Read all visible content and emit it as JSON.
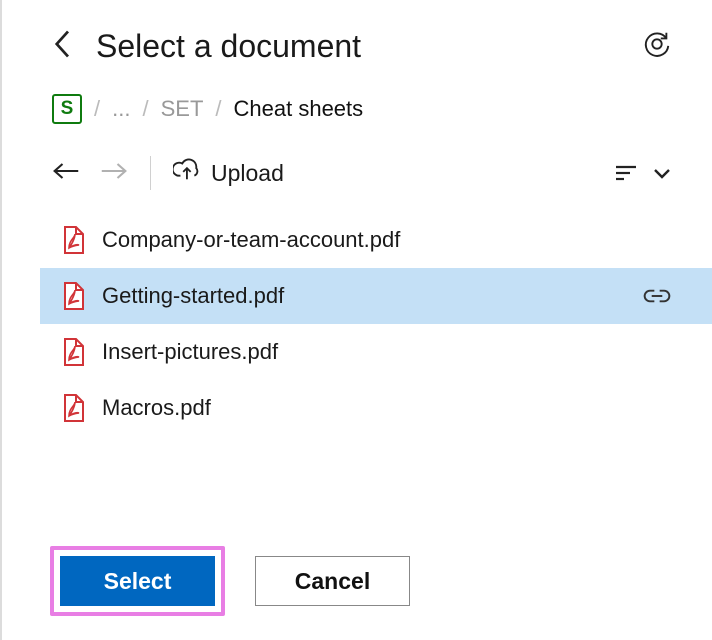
{
  "header": {
    "title": "Select a document"
  },
  "breadcrumb": {
    "root_badge": "S",
    "ellipsis": "...",
    "items": [
      "SET",
      "Cheat sheets"
    ]
  },
  "toolbar": {
    "upload_label": "Upload"
  },
  "files": [
    {
      "name": "Company-or-team-account.pdf",
      "selected": false
    },
    {
      "name": "Getting-started.pdf",
      "selected": true
    },
    {
      "name": "Insert-pictures.pdf",
      "selected": false
    },
    {
      "name": "Macros.pdf",
      "selected": false
    }
  ],
  "footer": {
    "select_label": "Select",
    "cancel_label": "Cancel"
  },
  "colors": {
    "primary": "#0067c0",
    "highlight": "#e87ee4",
    "selected_row": "#c4e0f6",
    "pdf_red": "#d13438"
  }
}
